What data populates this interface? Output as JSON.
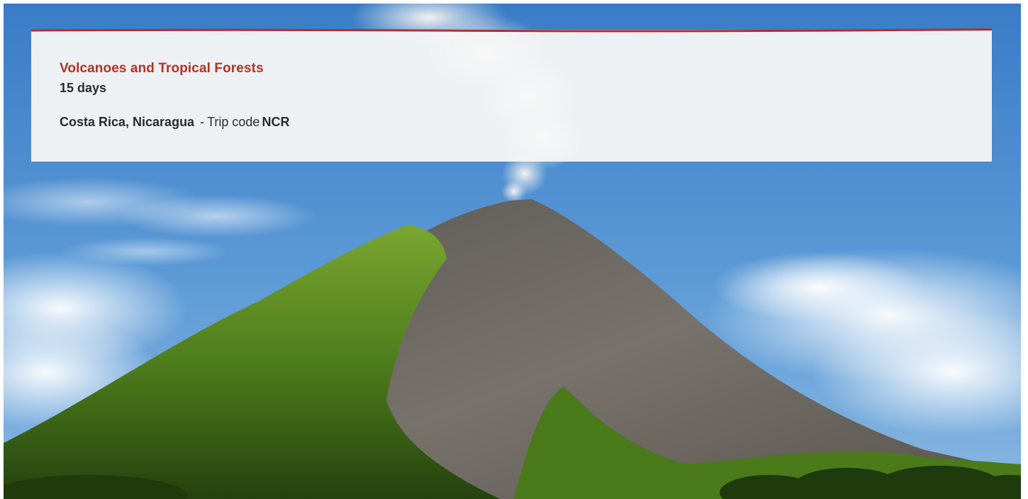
{
  "trip": {
    "title": "Volcanoes and Tropical Forests",
    "duration": "15 days",
    "destinations": "Costa Rica, Nicaragua",
    "separator": "-",
    "code_label": "Trip code",
    "code_value": "NCR"
  },
  "hero": {
    "image_subject": "volcano-with-smoke-plume",
    "sky_color": "#4f8fd0",
    "forest_color": "#5a8a1e",
    "ash_color": "#6e6963"
  },
  "colors": {
    "accent": "#b23125",
    "text": "#2b2b2b",
    "panel": "#f8f8f6"
  }
}
